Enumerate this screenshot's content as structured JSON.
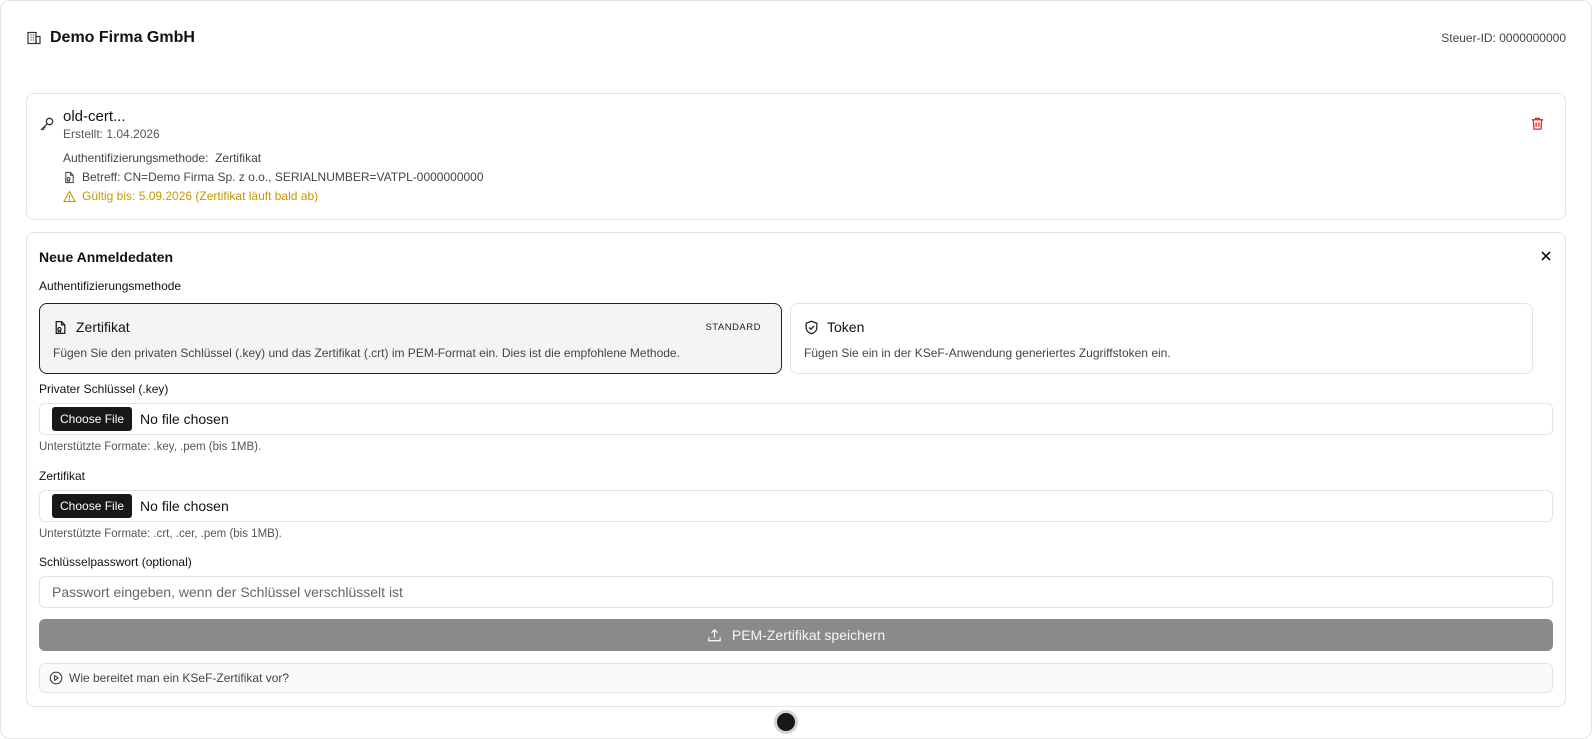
{
  "header": {
    "company_icon": "building-icon",
    "company_name": "Demo Firma GmbH",
    "tax_id": "Steuer-ID: 0000000000"
  },
  "existing_certificate": {
    "icon": "key-icon",
    "name": "old-cert...",
    "created": "Erstellt: 1.04.2026",
    "method": "Authentifizierungsmethode:  Zertifikat",
    "subject": "Betreff: CN=Demo Firma Sp. z o.o., SERIALNUMBER=VATPL-0000000000",
    "valid_until": "Gültig bis: 5.09.2026 (Zertifikat läuft bald ab)",
    "warning_color": "#c79800",
    "delete_icon": "trash-icon",
    "delete_color": "#dc2626"
  },
  "form": {
    "title": "Neue Anmeldedaten",
    "auth_method_label": "Authentifizierungsmethode",
    "methods": [
      {
        "title": "Zertifikat",
        "badge": "STANDARD",
        "description": "Fügen Sie den privaten Schlüssel (.key) und das Zertifikat (.crt) im PEM-Format ein. Dies ist die empfohlene Methode.",
        "icon": "file-certificate-icon",
        "selected": true
      },
      {
        "title": "Token",
        "description": "Fügen Sie ein in der KSeF-Anwendung generiertes Zugriffstoken ein.",
        "icon": "shield-check-icon",
        "selected": false
      }
    ],
    "private_key": {
      "label": "Privater Schlüssel (.key)",
      "button": "Choose File",
      "status": "No file chosen",
      "hint": "Unterstützte Formate: .key, .pem (bis 1MB)."
    },
    "certificate": {
      "label": "Zertifikat",
      "button": "Choose File",
      "status": "No file chosen",
      "hint": "Unterstützte Formate: .crt, .cer, .pem (bis 1MB)."
    },
    "password": {
      "label": "Schlüsselpasswort (optional)",
      "placeholder": "Passwort eingeben, wenn der Schlüssel verschlüsselt ist"
    },
    "save_button": "PEM-Zertifikat speichern",
    "help_link": "Wie bereitet man ein KSeF-Zertifikat vor?"
  }
}
